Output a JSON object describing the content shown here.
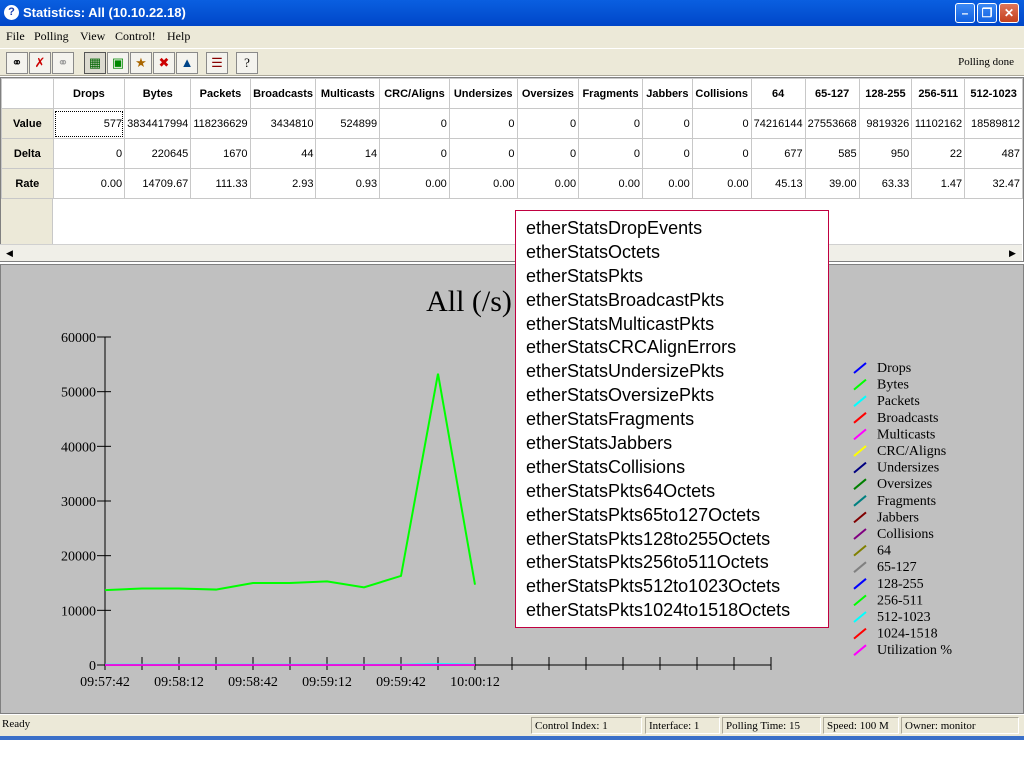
{
  "window": {
    "title": "Statistics: All (10.10.22.18)",
    "controls": [
      "minimize",
      "maximize",
      "close"
    ]
  },
  "menu": [
    "File",
    "Polling",
    "View",
    "Control!",
    "Help"
  ],
  "toolbar": {
    "icons": [
      "connect-icon",
      "disconnect-icon",
      "refresh-icon",
      "table-icon",
      "database-icon",
      "chart-icon",
      "delete-icon",
      "stats-icon",
      "settings-icon",
      "help-icon"
    ],
    "status": "Polling done"
  },
  "table": {
    "columns": [
      "Drops",
      "Bytes",
      "Packets",
      "Broadcasts",
      "Multicasts",
      "CRC/Aligns",
      "Undersizes",
      "Oversizes",
      "Fragments",
      "Jabbers",
      "Collisions",
      "64",
      "65-127",
      "128-255",
      "256-511",
      "512-1023"
    ],
    "rows": [
      {
        "label": "Value",
        "cells": [
          "577",
          "3834417994",
          "118236629",
          "3434810",
          "524899",
          "0",
          "0",
          "0",
          "0",
          "0",
          "0",
          "74216144",
          "27553668",
          "9819326",
          "11102162",
          "18589812"
        ]
      },
      {
        "label": "Delta",
        "cells": [
          "0",
          "220645",
          "1670",
          "44",
          "14",
          "0",
          "0",
          "0",
          "0",
          "0",
          "0",
          "677",
          "585",
          "950",
          "22",
          "487"
        ]
      },
      {
        "label": "Rate",
        "cells": [
          "0.00",
          "14709.67",
          "111.33",
          "2.93",
          "0.93",
          "0.00",
          "0.00",
          "0.00",
          "0.00",
          "0.00",
          "0.00",
          "45.13",
          "39.00",
          "63.33",
          "1.47",
          "32.47"
        ]
      }
    ]
  },
  "chart_data": {
    "type": "line",
    "title": "All (/s)",
    "x": [
      "09:57:42",
      "09:57:57",
      "09:58:12",
      "09:58:27",
      "09:58:42",
      "09:58:57",
      "09:59:12",
      "09:59:27",
      "09:59:42",
      "09:59:57",
      "10:00:12"
    ],
    "x_tick_labels": [
      "09:57:42",
      "09:58:12",
      "09:58:42",
      "09:59:12",
      "09:59:42",
      "10:00:12"
    ],
    "x_tick_count": 19,
    "ylim": [
      0,
      60000
    ],
    "y_ticks": [
      "0",
      "10000",
      "20000",
      "30000",
      "40000",
      "50000",
      "60000"
    ],
    "series": [
      {
        "name": "Drops",
        "color": "#0000ff",
        "values": [
          0,
          0,
          0,
          0,
          0,
          0,
          0,
          0,
          0,
          0,
          0
        ]
      },
      {
        "name": "Bytes",
        "color": "#00ff00",
        "values": [
          13700,
          14000,
          14000,
          13800,
          15000,
          15000,
          15300,
          14200,
          16300,
          53300,
          14700
        ]
      },
      {
        "name": "Packets",
        "color": "#00ffff",
        "values": [
          100,
          100,
          100,
          100,
          100,
          100,
          100,
          100,
          100,
          200,
          111
        ]
      },
      {
        "name": "Broadcasts",
        "color": "#ff0000",
        "values": [
          0,
          0,
          0,
          0,
          0,
          0,
          0,
          0,
          0,
          0,
          0
        ]
      },
      {
        "name": "Multicasts",
        "color": "#ff00ff",
        "values": [
          0,
          0,
          0,
          0,
          0,
          0,
          0,
          0,
          0,
          0,
          0
        ]
      },
      {
        "name": "CRC/Aligns",
        "color": "#ffff00",
        "values": []
      },
      {
        "name": "Undersizes",
        "color": "#000080",
        "values": []
      },
      {
        "name": "Oversizes",
        "color": "#008000",
        "values": []
      },
      {
        "name": "Fragments",
        "color": "#008080",
        "values": []
      },
      {
        "name": "Jabbers",
        "color": "#800000",
        "values": []
      },
      {
        "name": "Collisions",
        "color": "#800080",
        "values": []
      },
      {
        "name": "64",
        "color": "#808000",
        "values": []
      },
      {
        "name": "65-127",
        "color": "#808080",
        "values": []
      },
      {
        "name": "128-255",
        "color": "#0000ff",
        "values": []
      },
      {
        "name": "256-511",
        "color": "#00ff00",
        "values": []
      },
      {
        "name": "512-1023",
        "color": "#00ffff",
        "values": []
      },
      {
        "name": "1024-1518",
        "color": "#ff0000",
        "values": []
      },
      {
        "name": "Utilization %",
        "color": "#ff00ff",
        "values": []
      }
    ]
  },
  "tooltip": {
    "items": [
      "etherStatsDropEvents",
      "etherStatsOctets",
      "etherStatsPkts",
      "etherStatsBroadcastPkts",
      "etherStatsMulticastPkts",
      "etherStatsCRCAlignErrors",
      "etherStatsUndersizePkts",
      "etherStatsOversizePkts",
      "etherStatsFragments",
      "etherStatsJabbers",
      "etherStatsCollisions",
      "etherStatsPkts64Octets",
      "etherStatsPkts65to127Octets",
      "etherStatsPkts128to255Octets",
      "etherStatsPkts256to511Octets",
      "etherStatsPkts512to1023Octets",
      "etherStatsPkts1024to1518Octets"
    ]
  },
  "statusbar": {
    "ready": "Ready",
    "control_index": "Control Index: 1",
    "interface": "Interface: 1",
    "polling_time": "Polling Time: 15",
    "speed": "Speed: 100 M",
    "owner": "Owner: monitor"
  }
}
